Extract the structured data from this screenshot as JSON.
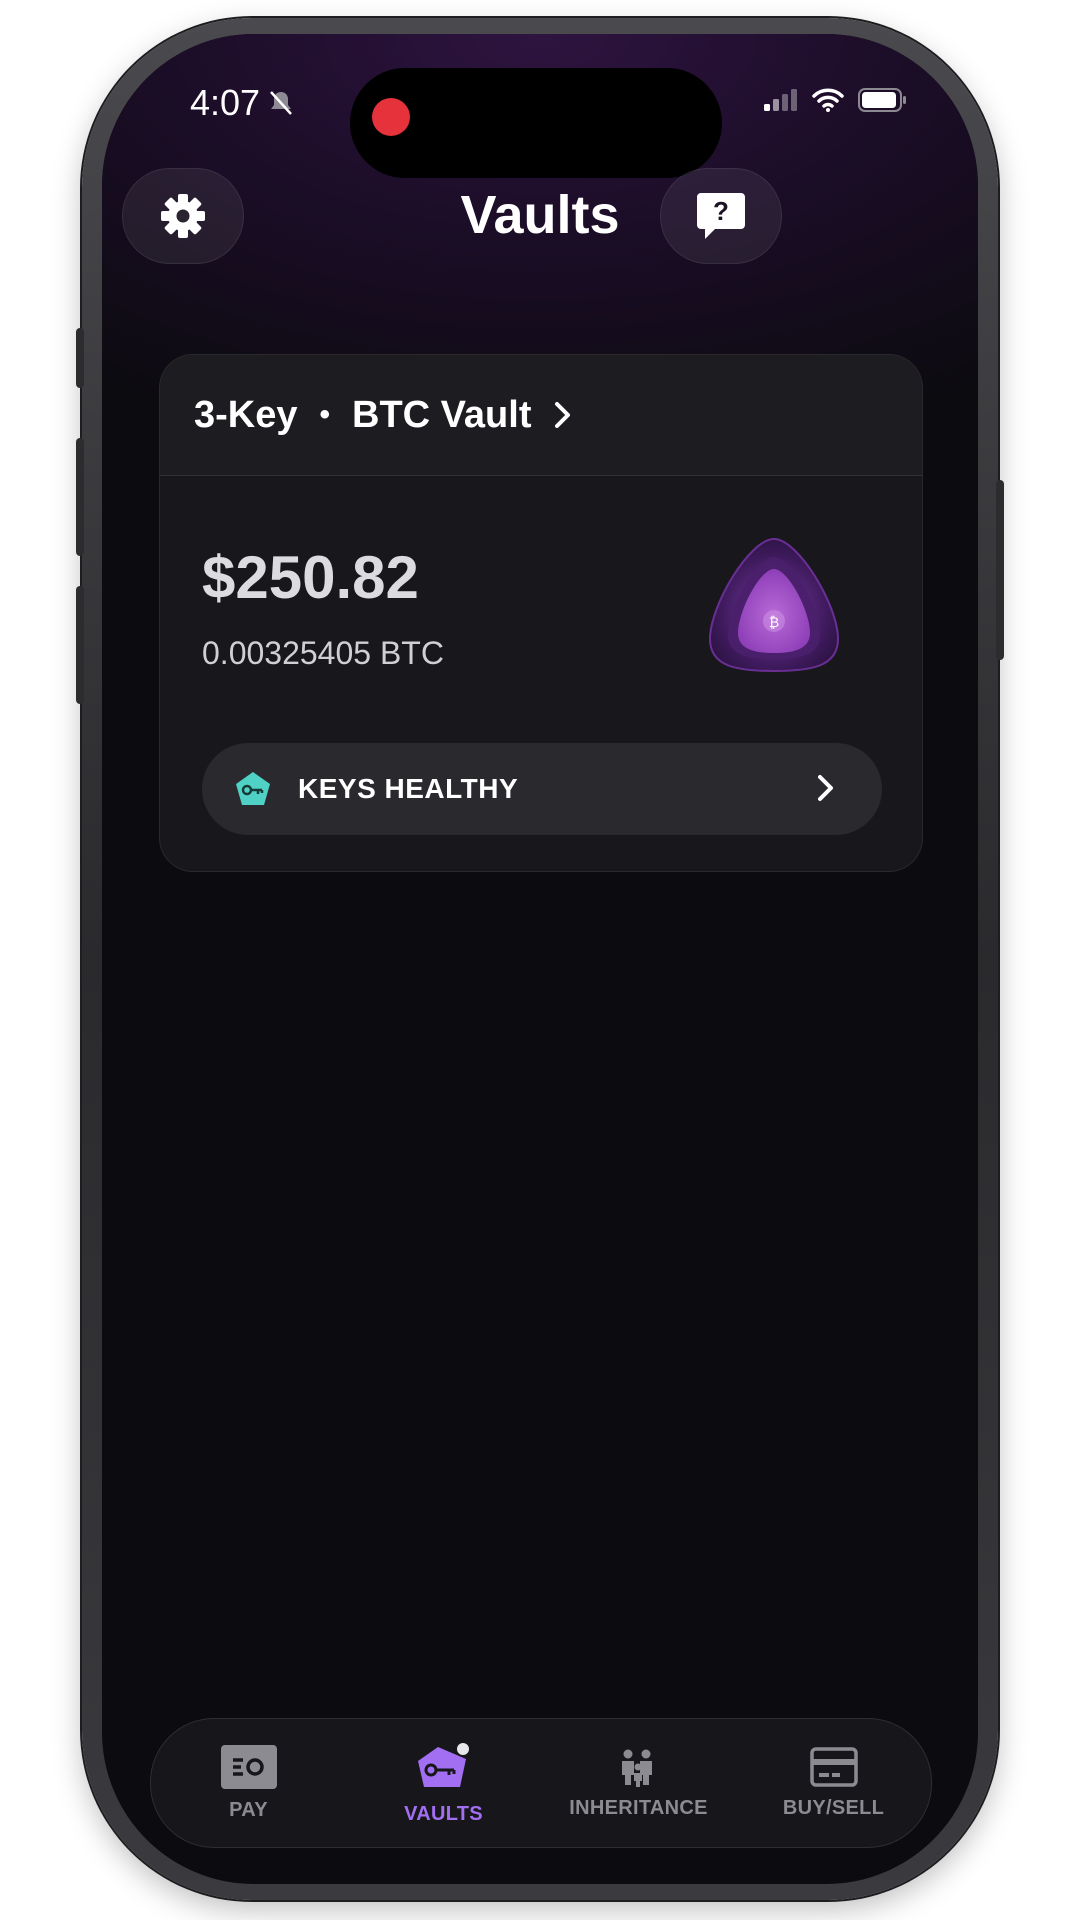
{
  "status_bar": {
    "time": "4:07"
  },
  "header": {
    "title": "Vaults",
    "settings_icon": "gear-icon",
    "help_icon": "help-chat-icon"
  },
  "vault_card": {
    "key_count": "3-Key",
    "separator": "•",
    "vault_name": "BTC Vault",
    "fiat_balance": "$250.82",
    "btc_balance": "0.00325405 BTC",
    "status_label": "KEYS HEALTHY",
    "status_color": "#4fd1c5"
  },
  "tabs": [
    {
      "label": "PAY",
      "icon": "pay-icon",
      "active": false
    },
    {
      "label": "VAULTS",
      "icon": "vault-key-icon",
      "active": true
    },
    {
      "label": "INHERITANCE",
      "icon": "family-icon",
      "active": false
    },
    {
      "label": "BUY/SELL",
      "icon": "card-icon",
      "active": false
    }
  ],
  "colors": {
    "accent": "#a36ff2",
    "background": "#0c0b10",
    "record": "#e5323b"
  }
}
